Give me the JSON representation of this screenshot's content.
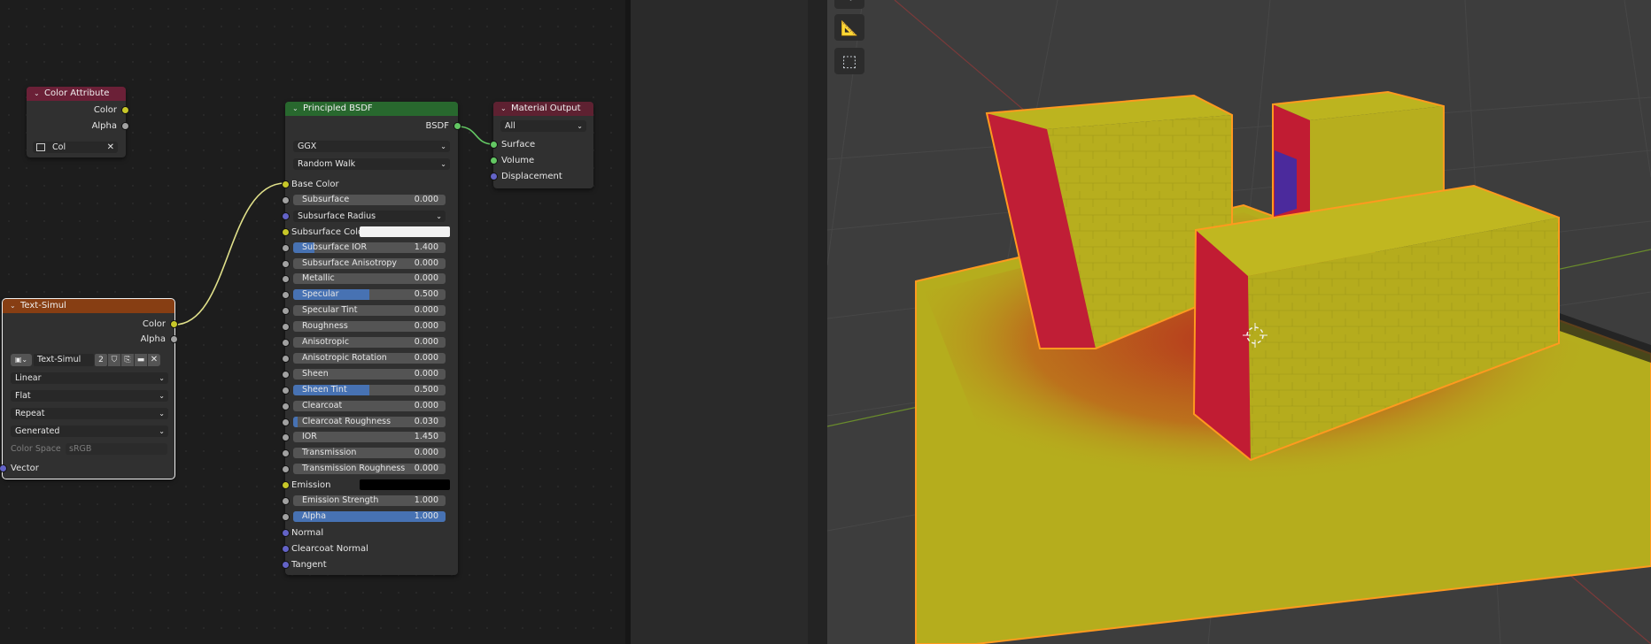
{
  "color_attribute_node": {
    "title": "Color Attribute",
    "outputs": [
      "Color",
      "Alpha"
    ],
    "attribute_name": "Col"
  },
  "principled_node": {
    "title": "Principled BSDF",
    "output": "BSDF",
    "distribution": "GGX",
    "subsurface_method": "Random Walk",
    "inputs": [
      {
        "label": "Base Color"
      },
      {
        "label": "Subsurface",
        "value": "0.000",
        "fill": 0
      },
      {
        "label": "Subsurface Radius"
      },
      {
        "label": "Subsurface Color"
      },
      {
        "label": "Subsurface IOR",
        "value": "1.400",
        "fill": 0.14
      },
      {
        "label": "Subsurface Anisotropy",
        "value": "0.000",
        "fill": 0
      },
      {
        "label": "Metallic",
        "value": "0.000",
        "fill": 0
      },
      {
        "label": "Specular",
        "value": "0.500",
        "fill": 0.5
      },
      {
        "label": "Specular Tint",
        "value": "0.000",
        "fill": 0
      },
      {
        "label": "Roughness",
        "value": "0.000",
        "fill": 0
      },
      {
        "label": "Anisotropic",
        "value": "0.000",
        "fill": 0
      },
      {
        "label": "Anisotropic Rotation",
        "value": "0.000",
        "fill": 0
      },
      {
        "label": "Sheen",
        "value": "0.000",
        "fill": 0
      },
      {
        "label": "Sheen Tint",
        "value": "0.500",
        "fill": 0.5
      },
      {
        "label": "Clearcoat",
        "value": "0.000",
        "fill": 0
      },
      {
        "label": "Clearcoat Roughness",
        "value": "0.030",
        "fill": 0.03
      },
      {
        "label": "IOR",
        "value": "1.450",
        "fill": 0
      },
      {
        "label": "Transmission",
        "value": "0.000",
        "fill": 0
      },
      {
        "label": "Transmission Roughness",
        "value": "0.000",
        "fill": 0
      },
      {
        "label": "Emission"
      },
      {
        "label": "Emission Strength",
        "value": "1.000",
        "fill": 0
      },
      {
        "label": "Alpha",
        "value": "1.000",
        "fill": 1
      },
      {
        "label": "Normal"
      },
      {
        "label": "Clearcoat Normal"
      },
      {
        "label": "Tangent"
      }
    ]
  },
  "material_output_node": {
    "title": "Material Output",
    "target": "All",
    "inputs": [
      "Surface",
      "Volume",
      "Displacement"
    ]
  },
  "image_texture_node": {
    "title": "Text-Simul",
    "outputs": [
      "Color",
      "Alpha"
    ],
    "image_name": "Text-Simul",
    "users": "2",
    "interpolation": "Linear",
    "projection": "Flat",
    "extension": "Repeat",
    "source": "Generated",
    "color_space_label": "Color Space",
    "color_space_value": "sRGB",
    "input": "Vector"
  },
  "colors": {
    "selection_outline": "#ff9a1f",
    "accent_blue": "#4772b3",
    "viewport_bg": "#3d3d3d"
  }
}
